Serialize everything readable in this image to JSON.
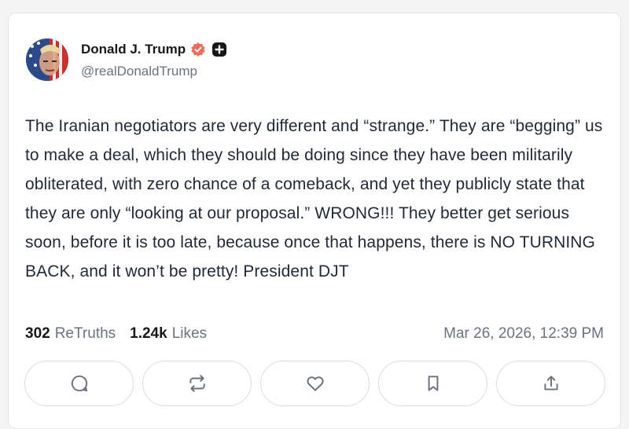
{
  "post": {
    "author": {
      "name": "Donald J. Trump",
      "handle": "@realDonaldTrump",
      "verified_icon": "verified-badge-icon",
      "plus_icon": "plus-badge-icon",
      "verified_color": "#ef6c5c"
    },
    "text": "The Iranian negotiators are very different and “strange.” They are “begging” us to make a deal, which they should be doing since they have been militarily obliterated, with zero chance of a comeback, and yet they publicly state that they are only “looking at our proposal.” WRONG!!! They better get serious soon, before it is too late, because once that happens, there is NO TURNING BACK, and it won’t be pretty! President DJT",
    "stats": {
      "retruths_count": "302",
      "retruths_label": "ReTruths",
      "likes_count": "1.24k",
      "likes_label": "Likes"
    },
    "timestamp": "Mar 26, 2026, 12:39 PM"
  },
  "actions": [
    {
      "name": "reply",
      "icon": "comment-icon"
    },
    {
      "name": "retruth",
      "icon": "repost-icon"
    },
    {
      "name": "like",
      "icon": "heart-icon"
    },
    {
      "name": "bookmark",
      "icon": "bookmark-icon"
    },
    {
      "name": "share",
      "icon": "share-icon"
    }
  ]
}
